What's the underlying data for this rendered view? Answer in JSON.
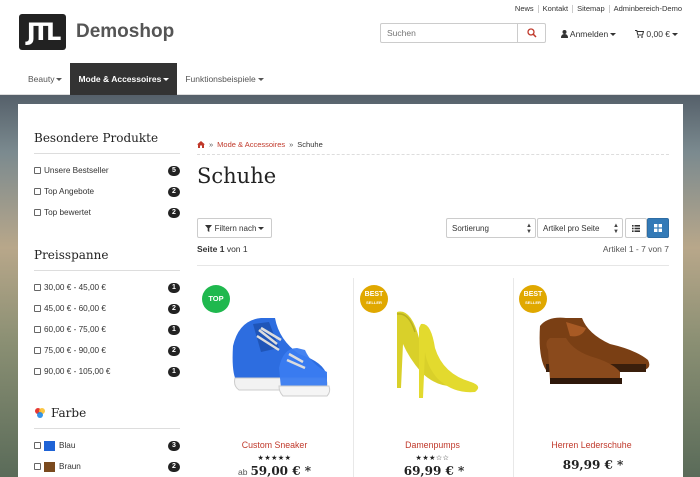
{
  "topbar": {
    "links": [
      "News",
      "Kontakt",
      "Sitemap",
      "Adminbereich-Demo"
    ]
  },
  "header": {
    "logo_text": "JTL",
    "brand": "Demoshop",
    "search_placeholder": "Suchen",
    "account_label": "Anmelden",
    "cart_label": "0,00 €"
  },
  "nav": {
    "items": [
      "Beauty",
      "Mode & Accessoires",
      "Funktionsbeispiele"
    ],
    "active_index": 1
  },
  "sidebar": {
    "special": {
      "title": "Besondere Produkte",
      "items": [
        {
          "label": "Unsere Bestseller",
          "count": "5"
        },
        {
          "label": "Top Angebote",
          "count": "2"
        },
        {
          "label": "Top bewertet",
          "count": "2"
        }
      ]
    },
    "price": {
      "title": "Preisspanne",
      "items": [
        {
          "label": "30,00 € - 45,00 €",
          "count": "1"
        },
        {
          "label": "45,00 € - 60,00 €",
          "count": "2"
        },
        {
          "label": "60,00 € - 75,00 €",
          "count": "1"
        },
        {
          "label": "75,00 € - 90,00 €",
          "count": "2"
        },
        {
          "label": "90,00 € - 105,00 €",
          "count": "1"
        }
      ]
    },
    "color": {
      "title": "Farbe",
      "items": [
        {
          "label": "Blau",
          "count": "3",
          "swatch": "#1e63d6"
        },
        {
          "label": "Braun",
          "count": "2",
          "swatch": "#7a4a1e"
        }
      ]
    }
  },
  "breadcrumb": {
    "items": [
      "Mode & Accessoires",
      "Schuhe"
    ]
  },
  "page": {
    "title": "Schuhe",
    "filter_label": "Filtern nach",
    "sort_label": "Sortierung",
    "per_page_label": "Artikel pro Seite",
    "page_word": "Seite",
    "page_current": "1",
    "page_of": "von 1",
    "count_label": "Artikel 1 - 7 von 7"
  },
  "products": [
    {
      "name": "Custom Sneaker",
      "stars": "★★★★★",
      "price_prefix": "ab",
      "price": "59,00 € *",
      "badge_line1": "TOP",
      "badge_line2": "",
      "badge_color": "#1fb84e"
    },
    {
      "name": "Damenpumps",
      "stars": "★★★☆☆",
      "price_prefix": "",
      "price": "69,99 € *",
      "badge_line1": "BEST",
      "badge_line2": "SELLER",
      "badge_color": "#e0a800"
    },
    {
      "name": "Herren Lederschuhe",
      "stars": "",
      "price_prefix": "",
      "price": "89,99 € *",
      "badge_line1": "BEST",
      "badge_line2": "SELLER",
      "badge_color": "#e0a800"
    }
  ]
}
